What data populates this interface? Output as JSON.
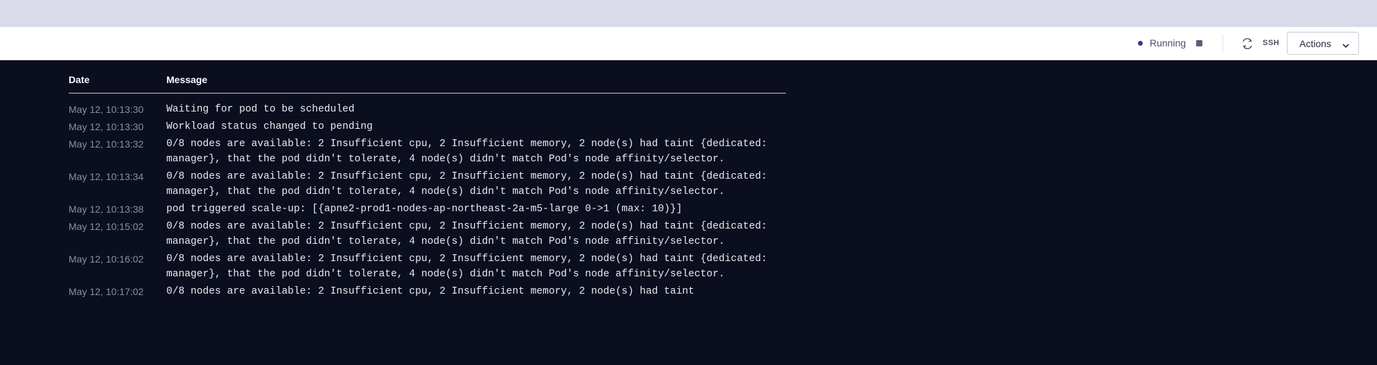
{
  "toolbar": {
    "status_label": "Running",
    "ssh_label": "SSH",
    "actions_label": "Actions"
  },
  "log": {
    "headers": {
      "date": "Date",
      "message": "Message"
    },
    "rows": [
      {
        "date": "May 12, 10:13:30",
        "message": "Waiting for pod to be scheduled"
      },
      {
        "date": "May 12, 10:13:30",
        "message": "Workload status changed to pending"
      },
      {
        "date": "May 12, 10:13:32",
        "message": "0/8 nodes are available: 2 Insufficient cpu, 2 Insufficient memory, 2 node(s) had taint {dedicated: manager}, that the pod didn't tolerate, 4 node(s) didn't match Pod's node affinity/selector."
      },
      {
        "date": "May 12, 10:13:34",
        "message": "0/8 nodes are available: 2 Insufficient cpu, 2 Insufficient memory, 2 node(s) had taint {dedicated: manager}, that the pod didn't tolerate, 4 node(s) didn't match Pod's node affinity/selector."
      },
      {
        "date": "May 12, 10:13:38",
        "message": "pod triggered scale-up: [{apne2-prod1-nodes-ap-northeast-2a-m5-large 0->1 (max: 10)}]"
      },
      {
        "date": "May 12, 10:15:02",
        "message": "0/8 nodes are available: 2 Insufficient cpu, 2 Insufficient memory, 2 node(s) had taint {dedicated: manager}, that the pod didn't tolerate, 4 node(s) didn't match Pod's node affinity/selector."
      },
      {
        "date": "May 12, 10:16:02",
        "message": "0/8 nodes are available: 2 Insufficient cpu, 2 Insufficient memory, 2 node(s) had taint {dedicated: manager}, that the pod didn't tolerate, 4 node(s) didn't match Pod's node affinity/selector."
      },
      {
        "date": "May 12, 10:17:02",
        "message": "0/8 nodes are available: 2 Insufficient cpu, 2 Insufficient memory, 2 node(s) had taint"
      }
    ]
  }
}
